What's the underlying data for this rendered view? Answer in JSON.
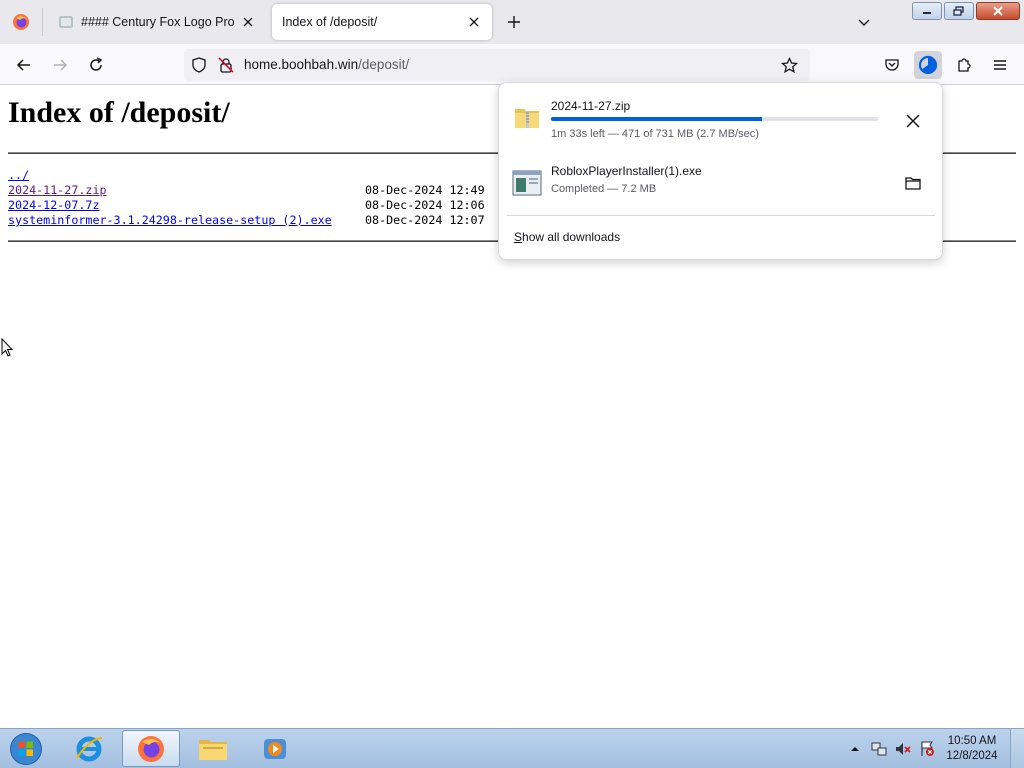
{
  "browser": {
    "tabs": [
      {
        "title": "#### Century Fox Logo Prototy",
        "active": false
      },
      {
        "title": "Index of /deposit/",
        "active": true
      }
    ],
    "url": {
      "host": "home.boohbah.win",
      "path": "/deposit/"
    }
  },
  "page": {
    "heading": "Index of /deposit/",
    "entries": [
      {
        "name": "../",
        "date": "",
        "visited": false
      },
      {
        "name": "2024-11-27.zip",
        "date": "08-Dec-2024 12:49",
        "visited": true
      },
      {
        "name": "2024-12-07.7z",
        "date": "08-Dec-2024 12:06",
        "visited": false
      },
      {
        "name": "systeminformer-3.1.24298-release-setup (2).exe",
        "date": "08-Dec-2024 12:07",
        "visited": false
      }
    ]
  },
  "downloads": {
    "items": [
      {
        "name": "2024-11-27.zip",
        "status": "1m 33s left — 471 of 731 MB (2.7 MB/sec)",
        "progress": 0.644,
        "icon": "zip-folder-icon",
        "action": "cancel"
      },
      {
        "name": "RobloxPlayerInstaller(1).exe",
        "status": "Completed — 7.2 MB",
        "icon": "exe-file-icon",
        "action": "show-in-folder"
      }
    ],
    "show_all": "Show all downloads",
    "show_all_access_key": "S",
    "show_all_rest": "how all downloads"
  },
  "taskbar": {
    "apps": [
      "internet-explorer-icon",
      "firefox-icon",
      "file-explorer-icon",
      "media-player-icon"
    ],
    "clock": {
      "time": "10:50 AM",
      "date": "12/8/2024"
    }
  },
  "colors": {
    "accent": "#0061e0",
    "link": "#0000ee",
    "visited_link": "#551a8b"
  }
}
